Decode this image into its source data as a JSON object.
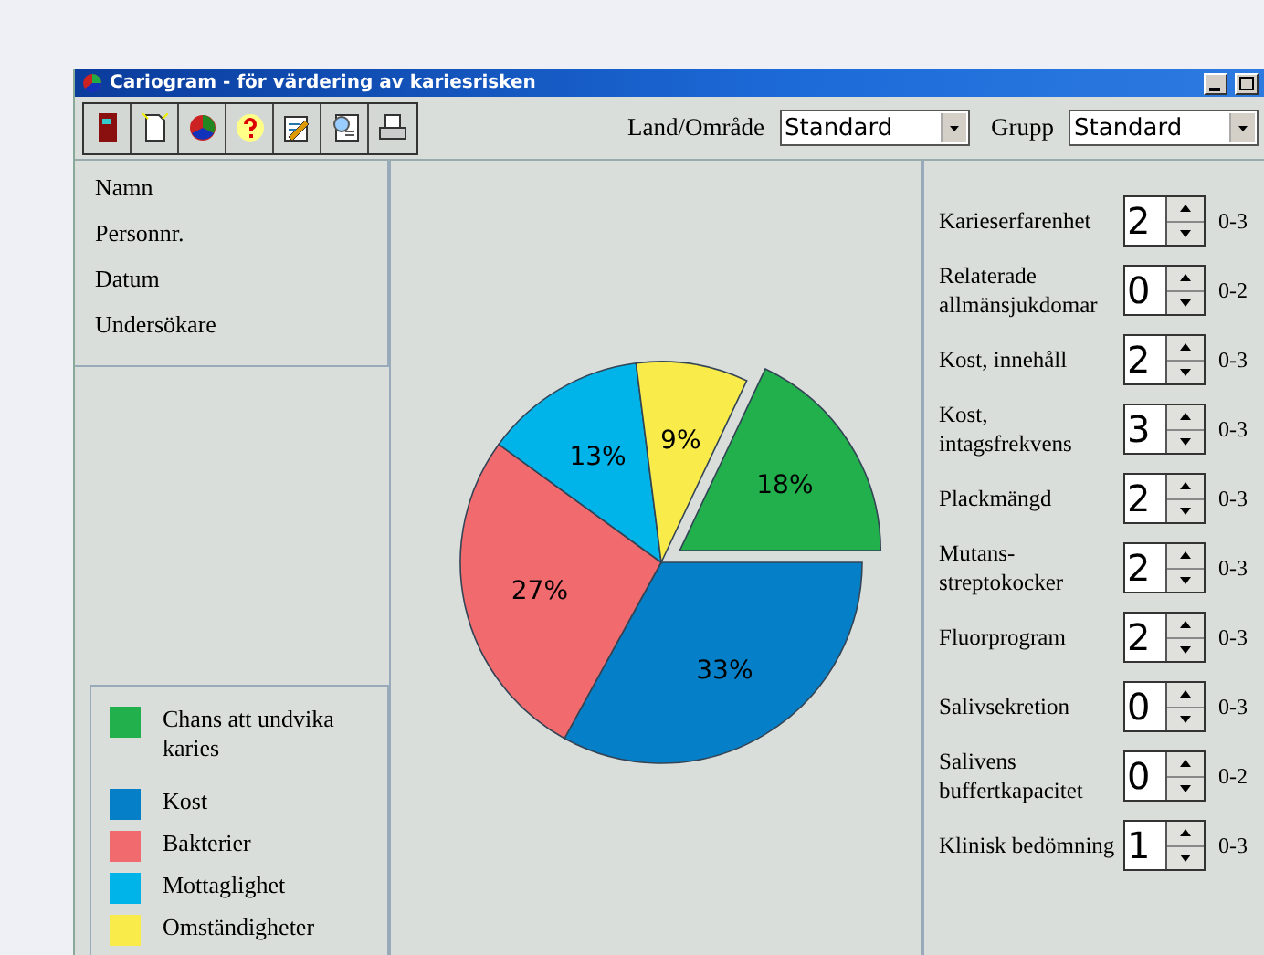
{
  "window": {
    "title": "Cariogram - för värdering av kariesrisken"
  },
  "toolbar": {
    "buttons": [
      {
        "kind": "door"
      },
      {
        "kind": "new"
      },
      {
        "kind": "pie"
      },
      {
        "kind": "help"
      },
      {
        "kind": "edit"
      },
      {
        "kind": "search"
      },
      {
        "kind": "print"
      }
    ],
    "selects": [
      {
        "label": "Land/Område",
        "value": "Standard"
      },
      {
        "label": "Grupp",
        "value": "Standard"
      }
    ]
  },
  "patient": {
    "fields": [
      "Namn",
      "Personnr.",
      "Datum",
      "Undersökare"
    ]
  },
  "chart": {
    "chart_data": {
      "type": "pie",
      "values": [
        18,
        33,
        27,
        13,
        9
      ],
      "value_labels": [
        "18%",
        "33%",
        "27%",
        "13%",
        "9%"
      ]
    }
  },
  "legend": [
    {
      "label": "Chans att undvika karies",
      "color": "#21b04b"
    },
    {
      "label": "Kost",
      "color": "#0580c8"
    },
    {
      "label": "Bakterier",
      "color": "#f06a6e"
    },
    {
      "label": "Mottaglighet",
      "color": "#00b4ea"
    },
    {
      "label": "Omständigheter",
      "color": "#f8eb4a"
    }
  ],
  "factors": [
    {
      "label": "Karieserfarenhet",
      "value": "2",
      "range": "0-3"
    },
    {
      "label": "Relaterade allmänsjukdomar",
      "value": "0",
      "range": "0-2"
    },
    {
      "label": "Kost, innehåll",
      "value": "2",
      "range": "0-3"
    },
    {
      "label": "Kost, intagsfrekvens",
      "value": "3",
      "range": "0-3"
    },
    {
      "label": "Plackmängd",
      "value": "2",
      "range": "0-3"
    },
    {
      "label": "Mutans-streptokocker",
      "value": "2",
      "range": "0-3"
    },
    {
      "label": "Fluorprogram",
      "value": "2",
      "range": "0-3"
    },
    {
      "label": "Salivsekretion",
      "value": "0",
      "range": "0-3"
    },
    {
      "label": "Salivens buffertkapacitet",
      "value": "0",
      "range": "0-2"
    },
    {
      "label": "Klinisk bedömning",
      "value": "1",
      "range": "0-3"
    }
  ]
}
